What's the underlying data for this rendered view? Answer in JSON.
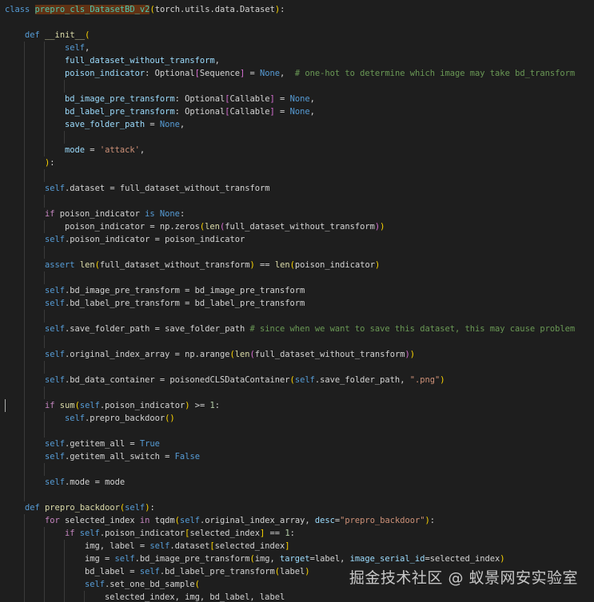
{
  "editor": {
    "language": "python",
    "theme": "dark",
    "cursor_line": 31,
    "colors": {
      "background": "#1e1e1e",
      "keyword": "#569cd6",
      "control": "#c586c0",
      "function": "#dcdcaa",
      "class": "#4ec9b0",
      "variable": "#9cdcfe",
      "string": "#ce9178",
      "number": "#b5cea8",
      "comment": "#6a9955",
      "bracket_1": "#ffd700",
      "bracket_2": "#da70d6",
      "bracket_3": "#179fff",
      "highlight": "#613214"
    },
    "lines": [
      {
        "indent": 0,
        "tokens": [
          [
            "kw",
            "class"
          ],
          [
            "pl",
            " "
          ],
          [
            "cls hl",
            "prepro_cls_DatasetBD_v2"
          ],
          [
            "p1",
            "("
          ],
          [
            "pl",
            "torch.utils.data.Dataset"
          ],
          [
            "p1",
            ")"
          ],
          [
            "pl",
            ":"
          ]
        ]
      },
      {
        "indent": 0,
        "tokens": []
      },
      {
        "indent": 1,
        "tokens": [
          [
            "kw",
            "def"
          ],
          [
            "pl",
            " "
          ],
          [
            "fn",
            "__init__"
          ],
          [
            "p1",
            "("
          ]
        ]
      },
      {
        "indent": 3,
        "tokens": [
          [
            "self",
            "self"
          ],
          [
            "pl",
            ","
          ]
        ]
      },
      {
        "indent": 3,
        "tokens": [
          [
            "var",
            "full_dataset_without_transform"
          ],
          [
            "pl",
            ","
          ]
        ]
      },
      {
        "indent": 3,
        "tokens": [
          [
            "var",
            "poison_indicator"
          ],
          [
            "pl",
            ": "
          ],
          [
            "pl",
            "Optional"
          ],
          [
            "p2",
            "["
          ],
          [
            "pl",
            "Sequence"
          ],
          [
            "p2",
            "]"
          ],
          [
            "pl",
            " = "
          ],
          [
            "kw",
            "None"
          ],
          [
            "pl",
            ",  "
          ],
          [
            "cmt",
            "# one-hot to determine which image may take bd_transform"
          ]
        ]
      },
      {
        "indent": 0,
        "tokens": []
      },
      {
        "indent": 3,
        "tokens": [
          [
            "var",
            "bd_image_pre_transform"
          ],
          [
            "pl",
            ": "
          ],
          [
            "pl",
            "Optional"
          ],
          [
            "p2",
            "["
          ],
          [
            "pl",
            "Callable"
          ],
          [
            "p2",
            "]"
          ],
          [
            "pl",
            " = "
          ],
          [
            "kw",
            "None"
          ],
          [
            "pl",
            ","
          ]
        ]
      },
      {
        "indent": 3,
        "tokens": [
          [
            "var",
            "bd_label_pre_transform"
          ],
          [
            "pl",
            ": "
          ],
          [
            "pl",
            "Optional"
          ],
          [
            "p2",
            "["
          ],
          [
            "pl",
            "Callable"
          ],
          [
            "p2",
            "]"
          ],
          [
            "pl",
            " = "
          ],
          [
            "kw",
            "None"
          ],
          [
            "pl",
            ","
          ]
        ]
      },
      {
        "indent": 3,
        "tokens": [
          [
            "var",
            "save_folder_path"
          ],
          [
            "pl",
            " = "
          ],
          [
            "kw",
            "None"
          ],
          [
            "pl",
            ","
          ]
        ]
      },
      {
        "indent": 0,
        "tokens": []
      },
      {
        "indent": 3,
        "tokens": [
          [
            "var",
            "mode"
          ],
          [
            "pl",
            " = "
          ],
          [
            "str",
            "'attack'"
          ],
          [
            "pl",
            ","
          ]
        ]
      },
      {
        "indent": 2,
        "tokens": [
          [
            "p1",
            ")"
          ],
          [
            "pl",
            ":"
          ]
        ]
      },
      {
        "indent": 0,
        "tokens": []
      },
      {
        "indent": 2,
        "tokens": [
          [
            "self",
            "self"
          ],
          [
            "pl",
            ".dataset = full_dataset_without_transform"
          ]
        ]
      },
      {
        "indent": 0,
        "tokens": []
      },
      {
        "indent": 2,
        "tokens": [
          [
            "ctl",
            "if"
          ],
          [
            "pl",
            " poison_indicator "
          ],
          [
            "kw",
            "is"
          ],
          [
            "pl",
            " "
          ],
          [
            "kw",
            "None"
          ],
          [
            "pl",
            ":"
          ]
        ]
      },
      {
        "indent": 3,
        "tokens": [
          [
            "pl",
            "poison_indicator = np.zeros"
          ],
          [
            "p1",
            "("
          ],
          [
            "fn",
            "len"
          ],
          [
            "p2",
            "("
          ],
          [
            "pl",
            "full_dataset_without_transform"
          ],
          [
            "p2",
            ")"
          ],
          [
            "p1",
            ")"
          ]
        ]
      },
      {
        "indent": 2,
        "tokens": [
          [
            "self",
            "self"
          ],
          [
            "pl",
            ".poison_indicator = poison_indicator"
          ]
        ]
      },
      {
        "indent": 0,
        "tokens": []
      },
      {
        "indent": 2,
        "tokens": [
          [
            "kw",
            "assert"
          ],
          [
            "pl",
            " "
          ],
          [
            "fn",
            "len"
          ],
          [
            "p1",
            "("
          ],
          [
            "pl",
            "full_dataset_without_transform"
          ],
          [
            "p1",
            ")"
          ],
          [
            "pl",
            " == "
          ],
          [
            "fn",
            "len"
          ],
          [
            "p1",
            "("
          ],
          [
            "pl",
            "poison_indicator"
          ],
          [
            "p1",
            ")"
          ]
        ]
      },
      {
        "indent": 0,
        "tokens": []
      },
      {
        "indent": 2,
        "tokens": [
          [
            "self",
            "self"
          ],
          [
            "pl",
            ".bd_image_pre_transform = bd_image_pre_transform"
          ]
        ]
      },
      {
        "indent": 2,
        "tokens": [
          [
            "self",
            "self"
          ],
          [
            "pl",
            ".bd_label_pre_transform = bd_label_pre_transform"
          ]
        ]
      },
      {
        "indent": 0,
        "tokens": []
      },
      {
        "indent": 2,
        "tokens": [
          [
            "self",
            "self"
          ],
          [
            "pl",
            ".save_folder_path = save_folder_path "
          ],
          [
            "cmt",
            "# since when we want to save this dataset, this may cause problem"
          ]
        ]
      },
      {
        "indent": 0,
        "tokens": []
      },
      {
        "indent": 2,
        "tokens": [
          [
            "self",
            "self"
          ],
          [
            "pl",
            ".original_index_array = np.arange"
          ],
          [
            "p1",
            "("
          ],
          [
            "fn",
            "len"
          ],
          [
            "p2",
            "("
          ],
          [
            "pl",
            "full_dataset_without_transform"
          ],
          [
            "p2",
            ")"
          ],
          [
            "p1",
            ")"
          ]
        ]
      },
      {
        "indent": 0,
        "tokens": []
      },
      {
        "indent": 2,
        "tokens": [
          [
            "self",
            "self"
          ],
          [
            "pl",
            ".bd_data_container = poisonedCLSDataContainer"
          ],
          [
            "p1",
            "("
          ],
          [
            "self",
            "self"
          ],
          [
            "pl",
            ".save_folder_path, "
          ],
          [
            "str",
            "\".png\""
          ],
          [
            "p1",
            ")"
          ]
        ]
      },
      {
        "indent": 0,
        "tokens": []
      },
      {
        "indent": 2,
        "tokens": [
          [
            "ctl",
            "if"
          ],
          [
            "pl",
            " "
          ],
          [
            "fn",
            "sum"
          ],
          [
            "p1",
            "("
          ],
          [
            "self",
            "self"
          ],
          [
            "pl",
            ".poison_indicator"
          ],
          [
            "p1",
            ")"
          ],
          [
            "pl",
            " >= "
          ],
          [
            "num",
            "1"
          ],
          [
            "pl",
            ":"
          ]
        ]
      },
      {
        "indent": 3,
        "tokens": [
          [
            "self",
            "self"
          ],
          [
            "pl",
            ".prepro_backdoor"
          ],
          [
            "p1",
            "("
          ],
          [
            "p1",
            ")"
          ]
        ]
      },
      {
        "indent": 0,
        "tokens": []
      },
      {
        "indent": 2,
        "tokens": [
          [
            "self",
            "self"
          ],
          [
            "pl",
            ".getitem_all = "
          ],
          [
            "kw",
            "True"
          ]
        ]
      },
      {
        "indent": 2,
        "tokens": [
          [
            "self",
            "self"
          ],
          [
            "pl",
            ".getitem_all_switch = "
          ],
          [
            "kw",
            "False"
          ]
        ]
      },
      {
        "indent": 0,
        "tokens": []
      },
      {
        "indent": 2,
        "tokens": [
          [
            "self",
            "self"
          ],
          [
            "pl",
            ".mode = mode"
          ]
        ]
      },
      {
        "indent": 0,
        "tokens": []
      },
      {
        "indent": 1,
        "tokens": [
          [
            "kw",
            "def"
          ],
          [
            "pl",
            " "
          ],
          [
            "fn",
            "prepro_backdoor"
          ],
          [
            "p1",
            "("
          ],
          [
            "self",
            "self"
          ],
          [
            "p1",
            ")"
          ],
          [
            "pl",
            ":"
          ]
        ]
      },
      {
        "indent": 2,
        "tokens": [
          [
            "ctl",
            "for"
          ],
          [
            "pl",
            " selected_index "
          ],
          [
            "ctl",
            "in"
          ],
          [
            "pl",
            " tqdm"
          ],
          [
            "p1",
            "("
          ],
          [
            "self",
            "self"
          ],
          [
            "pl",
            ".original_index_array, "
          ],
          [
            "var",
            "desc"
          ],
          [
            "pl",
            "="
          ],
          [
            "str",
            "\"prepro_backdoor\""
          ],
          [
            "p1",
            ")"
          ],
          [
            "pl",
            ":"
          ]
        ]
      },
      {
        "indent": 3,
        "tokens": [
          [
            "ctl",
            "if"
          ],
          [
            "pl",
            " "
          ],
          [
            "self",
            "self"
          ],
          [
            "pl",
            ".poison_indicator"
          ],
          [
            "p1",
            "["
          ],
          [
            "pl",
            "selected_index"
          ],
          [
            "p1",
            "]"
          ],
          [
            "pl",
            " == "
          ],
          [
            "num",
            "1"
          ],
          [
            "pl",
            ":"
          ]
        ]
      },
      {
        "indent": 4,
        "tokens": [
          [
            "pl",
            "img, label = "
          ],
          [
            "self",
            "self"
          ],
          [
            "pl",
            ".dataset"
          ],
          [
            "p1",
            "["
          ],
          [
            "pl",
            "selected_index"
          ],
          [
            "p1",
            "]"
          ]
        ]
      },
      {
        "indent": 4,
        "tokens": [
          [
            "pl",
            "img = "
          ],
          [
            "self",
            "self"
          ],
          [
            "pl",
            ".bd_image_pre_transform"
          ],
          [
            "p1",
            "("
          ],
          [
            "pl",
            "img, "
          ],
          [
            "var",
            "target"
          ],
          [
            "pl",
            "=label, "
          ],
          [
            "var",
            "image_serial_id"
          ],
          [
            "pl",
            "=selected_index"
          ],
          [
            "p1",
            ")"
          ]
        ]
      },
      {
        "indent": 4,
        "tokens": [
          [
            "pl",
            "bd_label = "
          ],
          [
            "self",
            "self"
          ],
          [
            "pl",
            ".bd_label_pre_transform"
          ],
          [
            "p1",
            "("
          ],
          [
            "pl",
            "label"
          ],
          [
            "p1",
            ")"
          ]
        ]
      },
      {
        "indent": 4,
        "tokens": [
          [
            "self",
            "self"
          ],
          [
            "pl",
            ".set_one_bd_sample"
          ],
          [
            "p1",
            "("
          ]
        ]
      },
      {
        "indent": 5,
        "tokens": [
          [
            "pl",
            "selected_index, img, bd_label, label"
          ]
        ]
      }
    ]
  },
  "watermark": {
    "text": "掘金技术社区 @ 蚁景网安实验室"
  }
}
